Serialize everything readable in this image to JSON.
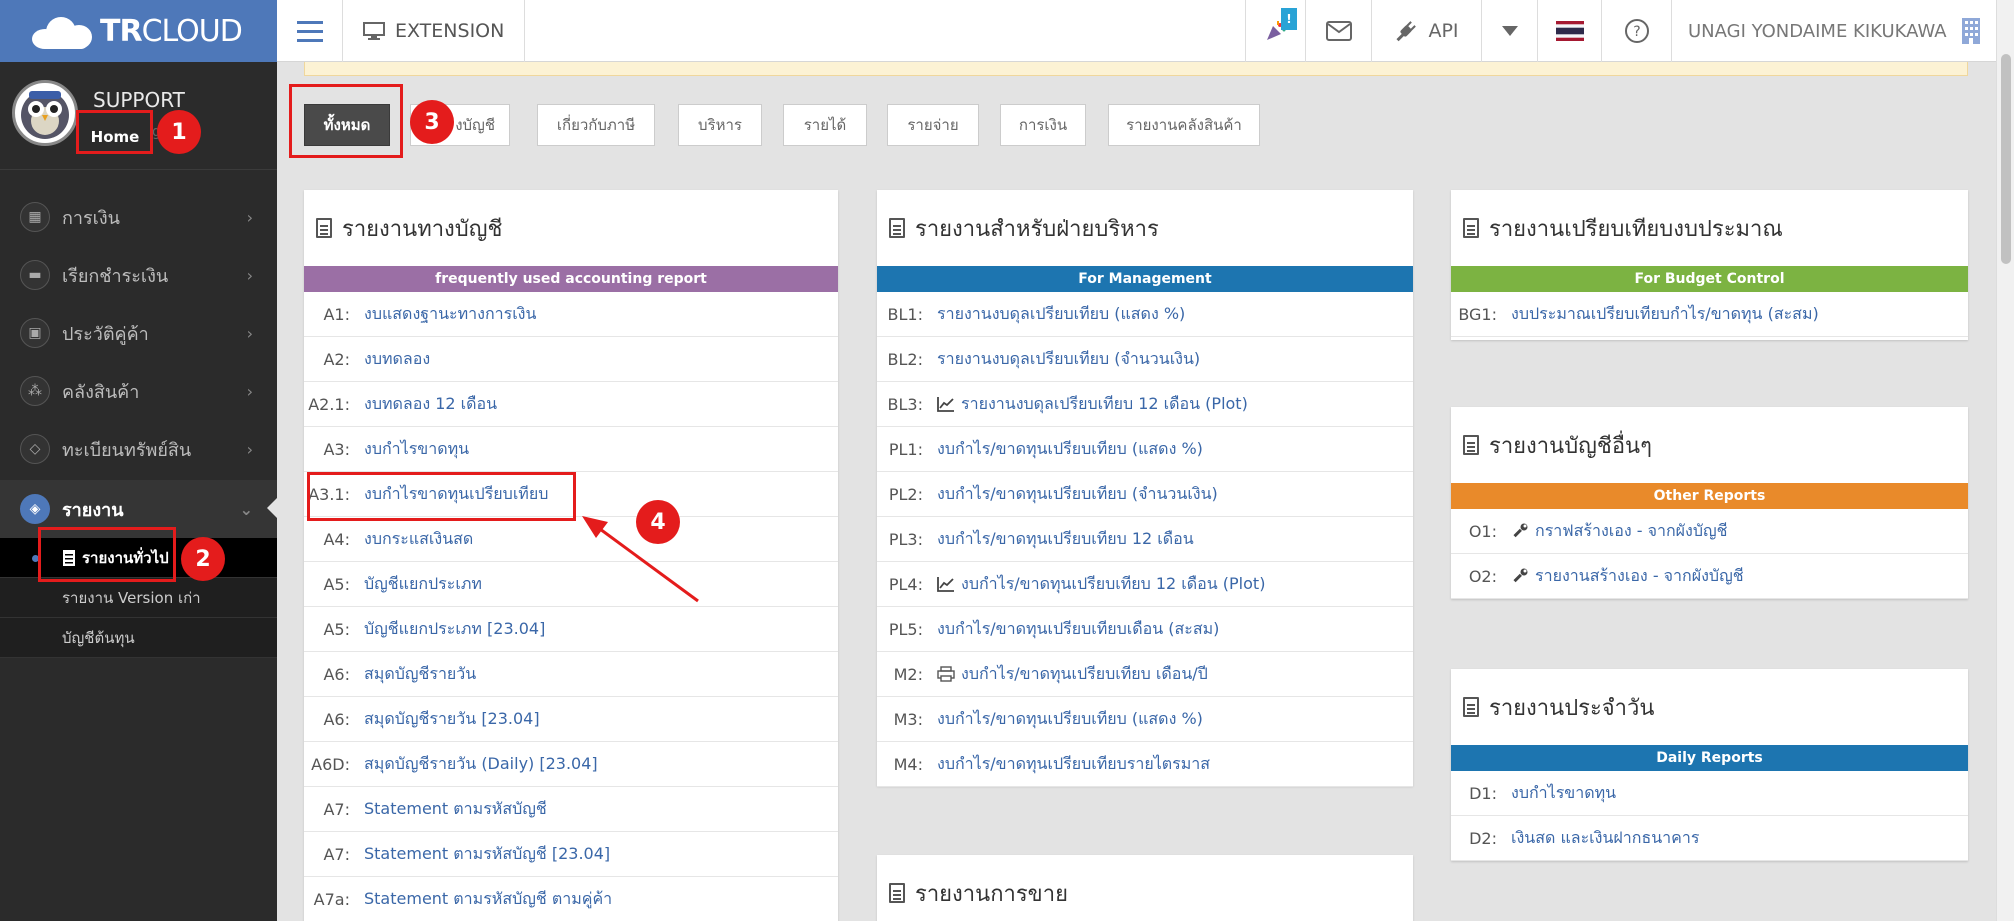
{
  "topbar": {
    "brand_bold": "TR",
    "brand_light": "CLOUD",
    "extension": "EXTENSION",
    "notif_badge": "!",
    "api": "API",
    "user": "UNAGI YONDAIME KIKUKAWA"
  },
  "sidebar": {
    "support": "SUPPORT",
    "home": "Home",
    "home_after": "g",
    "items": [
      {
        "label": "การเงิน"
      },
      {
        "label": "เรียกชำระเงิน"
      },
      {
        "label": "ประวัติคู่ค้า"
      },
      {
        "label": "คลังสินค้า"
      },
      {
        "label": "ทะเบียนทรัพย์สิน"
      },
      {
        "label": "รายงาน"
      }
    ],
    "subitems": [
      {
        "label": "รายงานทั่วไป"
      },
      {
        "label": "รายงาน Version เก่า"
      },
      {
        "label": "บัญชีต้นทุน"
      }
    ]
  },
  "tabs": [
    {
      "label": "ทั้งหมด"
    },
    {
      "label": "งบัญชี"
    },
    {
      "label": "เกี่ยวกับภาษี"
    },
    {
      "label": "บริหาร"
    },
    {
      "label": "รายได้"
    },
    {
      "label": "รายจ่าย"
    },
    {
      "label": "การเงิน"
    },
    {
      "label": "รายงานคลังสินค้า"
    }
  ],
  "cards": {
    "accounting": {
      "title": "รายงานทางบัญชี",
      "bar": "frequently used accounting report",
      "bar_color": "#9b6fa5",
      "rows": [
        {
          "code": "A1:",
          "text": "งบแสดงฐานะทางการเงิน"
        },
        {
          "code": "A2:",
          "text": "งบทดลอง"
        },
        {
          "code": "A2.1:",
          "text": "งบทดลอง 12 เดือน"
        },
        {
          "code": "A3:",
          "text": "งบกำไรขาดทุน"
        },
        {
          "code": "A3.1:",
          "text": "งบกำไรขาดทุนเปรียบเทียบ"
        },
        {
          "code": "A4:",
          "text": "งบกระแสเงินสด"
        },
        {
          "code": "A5:",
          "text": "บัญชีแยกประเภท"
        },
        {
          "code": "A5:",
          "text": "บัญชีแยกประเภท [23.04]"
        },
        {
          "code": "A6:",
          "text": "สมุดบัญชีรายวัน"
        },
        {
          "code": "A6:",
          "text": "สมุดบัญชีรายวัน [23.04]"
        },
        {
          "code": "A6D:",
          "text": "สมุดบัญชีรายวัน (Daily) [23.04]"
        },
        {
          "code": "A7:",
          "text": "Statement ตามรหัสบัญชี"
        },
        {
          "code": "A7:",
          "text": "Statement ตามรหัสบัญชี [23.04]"
        },
        {
          "code": "A7a:",
          "text": "Statement ตามรหัสบัญชี ตามคู่ค้า"
        }
      ]
    },
    "management": {
      "title": "รายงานสำหรับฝ่ายบริหาร",
      "bar": "For Management",
      "bar_color": "#1d75b0",
      "rows": [
        {
          "code": "BL1:",
          "text": "รายงานงบดุลเปรียบเทียบ (แสดง %)",
          "icon": ""
        },
        {
          "code": "BL2:",
          "text": "รายงานงบดุลเปรียบเทียบ (จำนวนเงิน)",
          "icon": ""
        },
        {
          "code": "BL3:",
          "text": "รายงานงบดุลเปรียบเทียบ 12 เดือน (Plot)",
          "icon": "chart-icon"
        },
        {
          "code": "PL1:",
          "text": "งบกำไร/ขาดทุนเปรียบเทียบ (แสดง %)",
          "icon": ""
        },
        {
          "code": "PL2:",
          "text": "งบกำไร/ขาดทุนเปรียบเทียบ (จำนวนเงิน)",
          "icon": ""
        },
        {
          "code": "PL3:",
          "text": "งบกำไร/ขาดทุนเปรียบเทียบ 12 เดือน",
          "icon": ""
        },
        {
          "code": "PL4:",
          "text": "งบกำไร/ขาดทุนเปรียบเทียบ 12 เดือน (Plot)",
          "icon": "chart-icon"
        },
        {
          "code": "PL5:",
          "text": "งบกำไร/ขาดทุนเปรียบเทียบเดือน (สะสม)",
          "icon": ""
        },
        {
          "code": "M2:",
          "text": "งบกำไร/ขาดทุนเปรียบเทียบ เดือน/ปี",
          "icon": "print-icon"
        },
        {
          "code": "M3:",
          "text": "งบกำไร/ขาดทุนเปรียบเทียบ (แสดง %)",
          "icon": ""
        },
        {
          "code": "M4:",
          "text": "งบกำไร/ขาดทุนเปรียบเทียบรายไตรมาส",
          "icon": ""
        }
      ]
    },
    "budget": {
      "title": "รายงานเปรียบเทียบงบประมาณ",
      "bar": "For Budget Control",
      "bar_color": "#7cb342",
      "rows": [
        {
          "code": "BG1:",
          "text": "งบประมาณเปรียบเทียบกำไร/ขาดทุน (สะสม)"
        }
      ]
    },
    "other": {
      "title": "รายงานบัญชีอื่นๆ",
      "bar": "Other Reports",
      "bar_color": "#e98a2a",
      "rows": [
        {
          "code": "O1:",
          "text": "กราฟสร้างเอง - จากผังบัญชี"
        },
        {
          "code": "O2:",
          "text": "รายงานสร้างเอง - จากผังบัญชี"
        }
      ]
    },
    "daily": {
      "title": "รายงานประจำวัน",
      "bar": "Daily Reports",
      "bar_color": "#1d75b0",
      "rows": [
        {
          "code": "D1:",
          "text": "งบกำไรขาดทุน"
        },
        {
          "code": "D2:",
          "text": "เงินสด และเงินฝากธนาคาร"
        }
      ]
    },
    "sales": {
      "title": "รายงานการขาย"
    }
  },
  "annotations": [
    "1",
    "2",
    "3",
    "4"
  ]
}
